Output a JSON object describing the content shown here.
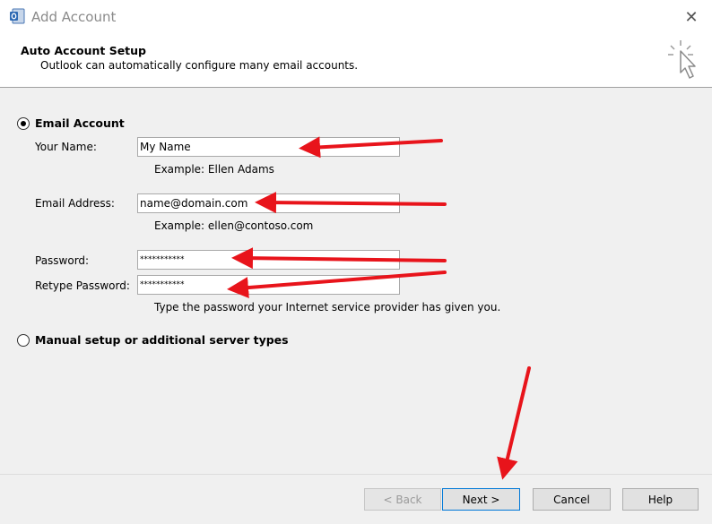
{
  "window": {
    "title": "Add Account",
    "close_glyph": "✕"
  },
  "header": {
    "title": "Auto Account Setup",
    "subtitle": "Outlook can automatically configure many email accounts."
  },
  "options": {
    "email_account": {
      "label": "Email Account",
      "selected": true
    },
    "manual_setup": {
      "label": "Manual setup or additional server types",
      "selected": false
    }
  },
  "form": {
    "name": {
      "label": "Your Name:",
      "value": "My Name",
      "hint": "Example: Ellen Adams"
    },
    "email": {
      "label": "Email Address:",
      "value": "name@domain.com",
      "hint": "Example: ellen@contoso.com"
    },
    "password": {
      "label": "Password:",
      "value": "***********"
    },
    "retype_password": {
      "label": "Retype Password:",
      "value": "***********",
      "hint": "Type the password your Internet service provider has given you."
    }
  },
  "buttons": {
    "back": "< Back",
    "next": "Next >",
    "cancel": "Cancel",
    "help": "Help"
  },
  "colors": {
    "annotation_arrow": "#e8141b",
    "background": "#f0f0f0",
    "header_background": "#ffffff"
  },
  "icons": [
    "outlook-app-icon",
    "close-icon",
    "wizard-cursor-icon",
    "annotation-arrow"
  ]
}
